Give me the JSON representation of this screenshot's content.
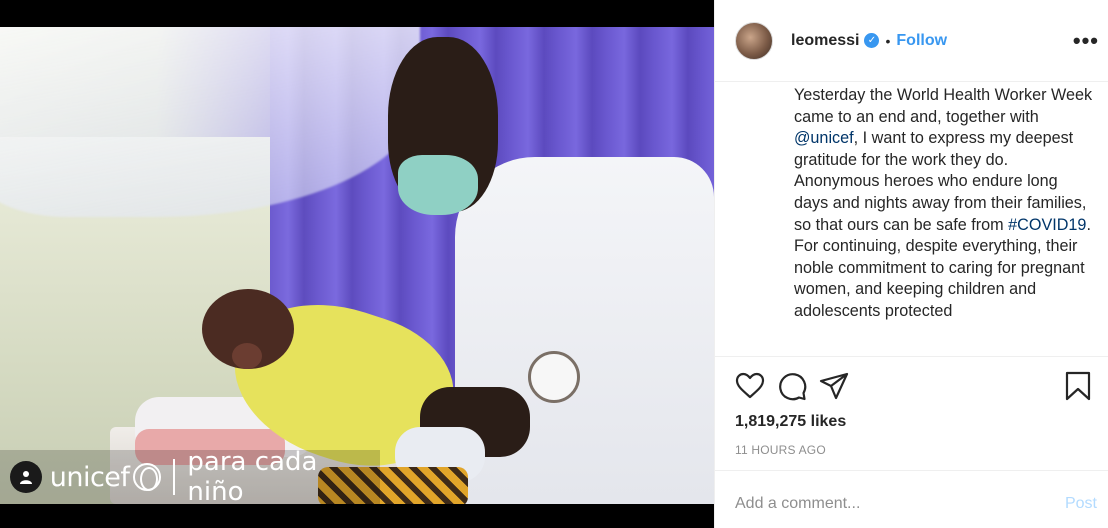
{
  "post": {
    "image": {
      "watermark": {
        "logo_text": "unicef",
        "tagline": "para cada niño"
      }
    },
    "header": {
      "username": "leomessi",
      "verified": "✓",
      "separator": "•",
      "follow_label": "Follow",
      "more_label": "•••"
    },
    "caption": {
      "line1": "Yesterday the World Health Worker Week came to an end and, together with ",
      "mention": "@unicef",
      "line1_end": ", I want to express my deepest gratitude for the work they do.",
      "line2": "Anonymous heroes who endure long days and nights away from their families, so that ours can be safe from ",
      "hashtag": "#COVID19",
      "line2_end": ".",
      "line3": "For continuing, despite everything, their noble commitment to caring for pregnant women, and keeping children and adolescents protected"
    },
    "actions": {
      "likes_label": "1,819,275 likes",
      "timestamp": "11 HOURS AGO"
    },
    "comment": {
      "placeholder": "Add a comment...",
      "post_label": "Post"
    },
    "colors": {
      "accent": "#3897f0",
      "link": "#003569",
      "muted": "#8e8e8e",
      "post_disabled": "#b3dbff"
    },
    "icons": [
      "user-tag-icon",
      "heart-icon",
      "comment-icon",
      "share-icon",
      "bookmark-icon",
      "more-icon",
      "verified-icon",
      "unicef-globe-icon"
    ]
  }
}
